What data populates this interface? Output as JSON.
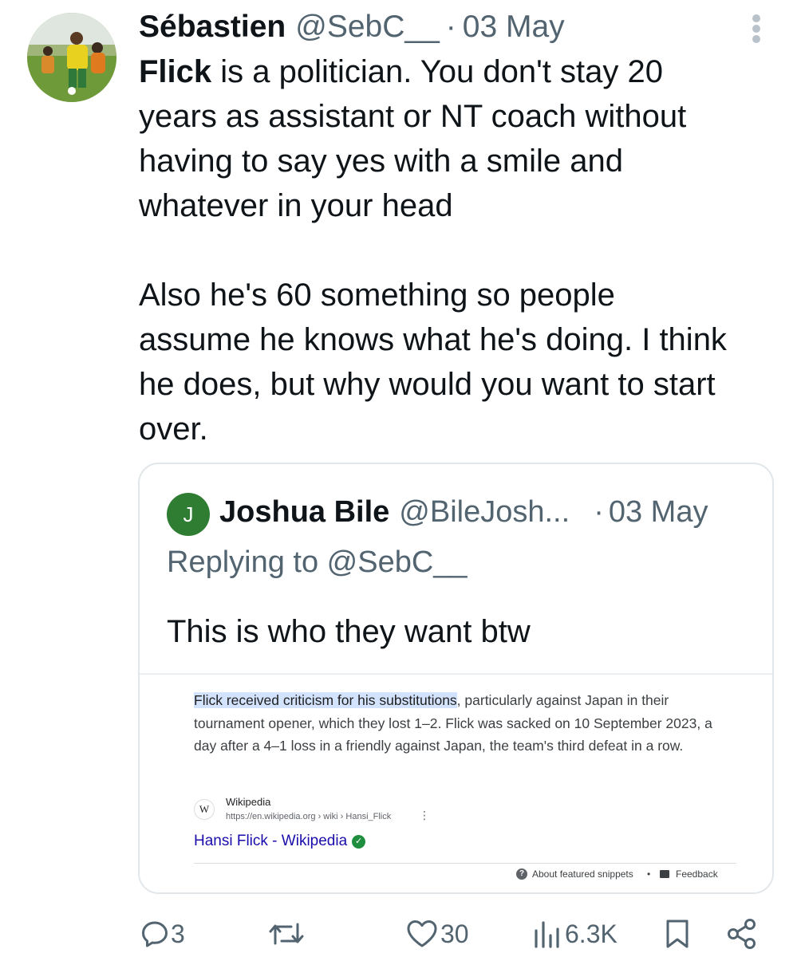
{
  "tweet": {
    "author_name": "Sébastien",
    "handle": "@SebC__",
    "separator": "·",
    "date": "03 May",
    "bold_lead": "Flick",
    "text": " is a politician. You don't stay 20\nyears as assistant or NT coach without\nhaving to say yes with a smile and\nwhatever in your head\n\nAlso he's 60 something so people\nassume he knows what he's doing. I think\nhe does, but why would you want to start\nover."
  },
  "quote": {
    "avatar_letter": "J",
    "author_name": "Joshua Bile",
    "handle": "@BileJosh...",
    "separator": "·",
    "date": "03 May",
    "replying_to": "Replying to @SebC__",
    "text": "This is who they want btw",
    "snippet": {
      "highlight": "Flick received criticism for his substitutions",
      "rest": ", particularly against Japan in their tournament opener, which they lost 1–2. Flick was sacked on 10 September 2023, a day after a 4–1 loss in a friendly against Japan, the team's third defeat in a row.",
      "source_icon": "W",
      "source_name": "Wikipedia",
      "source_url": "https://en.wikipedia.org › wiki › Hansi_Flick",
      "source_menu": "⋮",
      "link_title": "Hansi Flick - Wikipedia",
      "about_label": "About featured snippets",
      "footer_separator": "•",
      "feedback_label": "Feedback"
    }
  },
  "actions": {
    "replies": "3",
    "reposts": "",
    "likes": "30",
    "views": "6.3K"
  },
  "colors": {
    "text": "#0f1419",
    "secondary": "#536471",
    "border": "#e1e6ea",
    "link": "#1a0dab",
    "highlight": "#d3e3fd",
    "quote_avatar": "#2e7d32"
  }
}
